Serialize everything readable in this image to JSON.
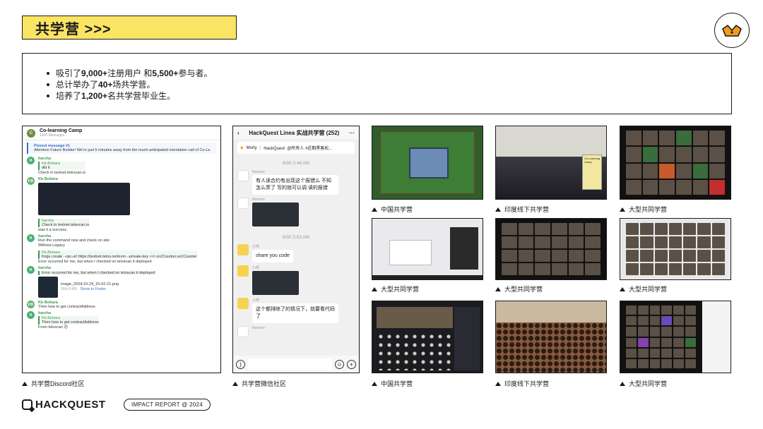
{
  "header": {
    "title": "共学营 >>>"
  },
  "brand": {
    "accent": "#fbe463",
    "logo_icon": "hackquest-crown-icon",
    "logo_color": "#f29a1a"
  },
  "bullets": [
    {
      "prefix": "吸引了 ",
      "strong1": "9,000+",
      "mid": " 注册用户 和 ",
      "strong2": "5,500+",
      "suffix": " 参与者。"
    },
    {
      "prefix": "总计举办了 ",
      "strong1": "40+",
      "mid": " 场共学营。",
      "strong2": "",
      "suffix": ""
    },
    {
      "prefix": "培养了 ",
      "strong1": "1,200+",
      "mid": " 名共学营毕业生。",
      "strong2": "",
      "suffix": ""
    }
  ],
  "discord": {
    "channel": "Co-learning Camp",
    "members": "1500 Messages",
    "pinned_label": "Pinned message #1",
    "pinned_text": "Attention Future Builder! We're just 5 minutes away from the much-anticipated orientation call of Co-Le",
    "messages": [
      {
        "user": "harsha",
        "quote_user": "Kb Bohara",
        "quote_text": "did it",
        "text": "Check in testnet.telescan.io"
      },
      {
        "user": "Kb Bohara",
        "text": ""
      },
      {
        "user": "harsha",
        "quote_text": "Check in testnet.telescan.io",
        "text": "was it a success"
      },
      {
        "user": "harsha",
        "text": "Run the command now and check on site",
        "text2": "Without Legacy"
      },
      {
        "user": "Kb Bohara",
        "code": "forge create --rpc-url https://testnet.telos.net/evm --private-key <>\\ src/Counter.sol:Counter",
        "text": "Error occurred for me, but when I checked on teloscan it deployed"
      },
      {
        "user": "harsha",
        "quote_text": "Error occurred for me, but when I checked on teloscan it deployed",
        "file": "image_2024-10-24_15-02-21.png",
        "file_size": "164.6 KB",
        "file_link": "Show in Finder"
      },
      {
        "user": "Kb Bohara",
        "text": "Then how to get contractAddress"
      },
      {
        "user": "harsha",
        "quote_user": "Kb Bohara",
        "quote_text": "Then how to get contractAddress",
        "text": "From teloscan 😊"
      }
    ]
  },
  "wechat": {
    "title": "HackQuest Linea 实战共学营 (252)",
    "notice_user": "Morty",
    "notice_text": "HackQuest: @所有人 #近期黑客松...",
    "time1": "9/30 2:48 AM",
    "user1": "Norman",
    "msg1": "有人读合约有出现这个报错么 不知怎么弄了 写的就可以调 读的报错",
    "user2": "Norman",
    "time2": "9/30 2:53 AM",
    "user3": "小邦",
    "msg3": "share you code",
    "user4": "小邦",
    "user5": "小邦",
    "msg5": "这个都排除了的情况下，就要看代码了",
    "user6": "Norman"
  },
  "captions": {
    "discord": "共学营Discord社区",
    "wechat": "共学营微信社区",
    "r1c1": "中国共学营",
    "r1c2": "印度线下共学营",
    "r1c3": "大型共同学营",
    "r2c1": "大型共同学营",
    "r2c2": "大型共同学营",
    "r2c3": "大型共同学营",
    "r3c1": "中国共学营",
    "r3c2": "印度线下共学营",
    "r3c3": "大型共同学营"
  },
  "photo_labels": {
    "co_learning_camp": "Co-Learning Camp"
  },
  "footer": {
    "brand": "HACKQUEST",
    "report": "IMPACT REPORT @ 2024"
  }
}
